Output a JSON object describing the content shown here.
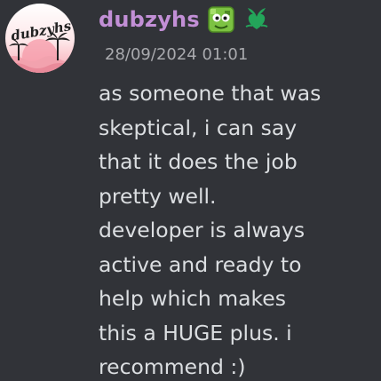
{
  "message": {
    "author": {
      "username": "dubzyhs",
      "avatar_text": "dubzyhs",
      "badges": [
        {
          "icon": "green-blob-face-icon"
        },
        {
          "icon": "leaf-heart-icon"
        }
      ]
    },
    "timestamp": "28/09/2024 01:01",
    "lines": [
      "as someone that was",
      "skeptical, i can say",
      "that it does the job",
      "pretty well.",
      "developer is always",
      "active and ready to",
      "help which makes",
      "this a HUGE plus. i",
      "recommend :)"
    ]
  },
  "colors": {
    "background": "#313338",
    "username": "#c28fd6",
    "timestamp": "#a9aaae",
    "text": "#dbdee1",
    "badge_green": "#23a55a"
  }
}
